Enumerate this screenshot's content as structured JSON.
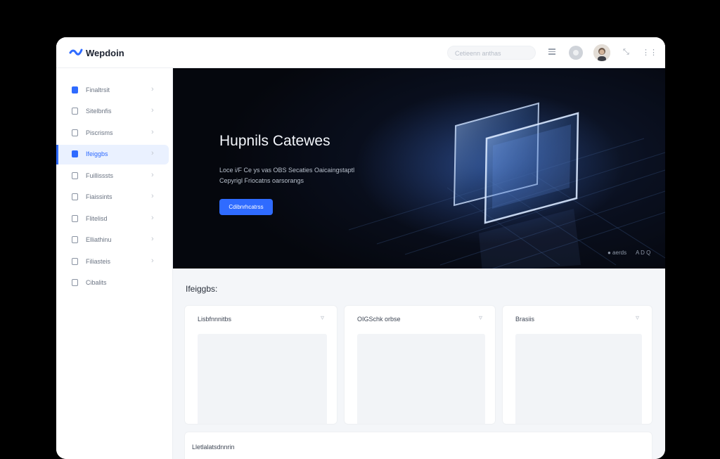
{
  "app": {
    "title": "Wepdoin"
  },
  "topbar": {
    "search_placeholder": "Cetieenn anthas",
    "icons": [
      "menu-icon",
      "settings-icon",
      "avatar",
      "expand-icon",
      "grid-icon"
    ]
  },
  "sidebar": {
    "items": [
      {
        "label": "Finaltrsit",
        "icon": "dashboard-icon",
        "active": false
      },
      {
        "label": "Sitelbnfis",
        "icon": "document-icon",
        "active": false
      },
      {
        "label": "Piscrisms",
        "icon": "file-icon",
        "active": false
      },
      {
        "label": "Ifeiggbs",
        "icon": "image-icon",
        "active": true
      },
      {
        "label": "Fuillisssts",
        "icon": "folder-icon",
        "active": false
      },
      {
        "label": "Fiaissints",
        "icon": "book-icon",
        "active": false
      },
      {
        "label": "Flitelisd",
        "icon": "mail-icon",
        "active": false
      },
      {
        "label": "Elliathinu",
        "icon": "chart-icon",
        "active": false
      },
      {
        "label": "Filiasteis",
        "icon": "layers-icon",
        "active": false
      },
      {
        "label": "Cibalits",
        "icon": "settings-icon",
        "active": false
      }
    ]
  },
  "hero": {
    "title": "Hupnils Catewes",
    "subtitle": "Loce i/F Ce ys vas OBS Secaties Oaicaingstaptl Cepyrigl Friocatns oarsorangs",
    "button_label": "Cdibnrhcatrss",
    "footer_left": "● aerds",
    "footer_right": "A D Q"
  },
  "main": {
    "section_title": "Ifeiggbs:",
    "cards": [
      {
        "title": "Lisbfnnnitbs"
      },
      {
        "title": "OIGSchk orbse"
      },
      {
        "title": "Brasiis"
      }
    ],
    "bottom_title": "Lletlalatsdnnrin"
  },
  "colors": {
    "accent": "#2f6bff",
    "hero_bg": "#070b14",
    "page_bg": "#f4f6f9"
  }
}
